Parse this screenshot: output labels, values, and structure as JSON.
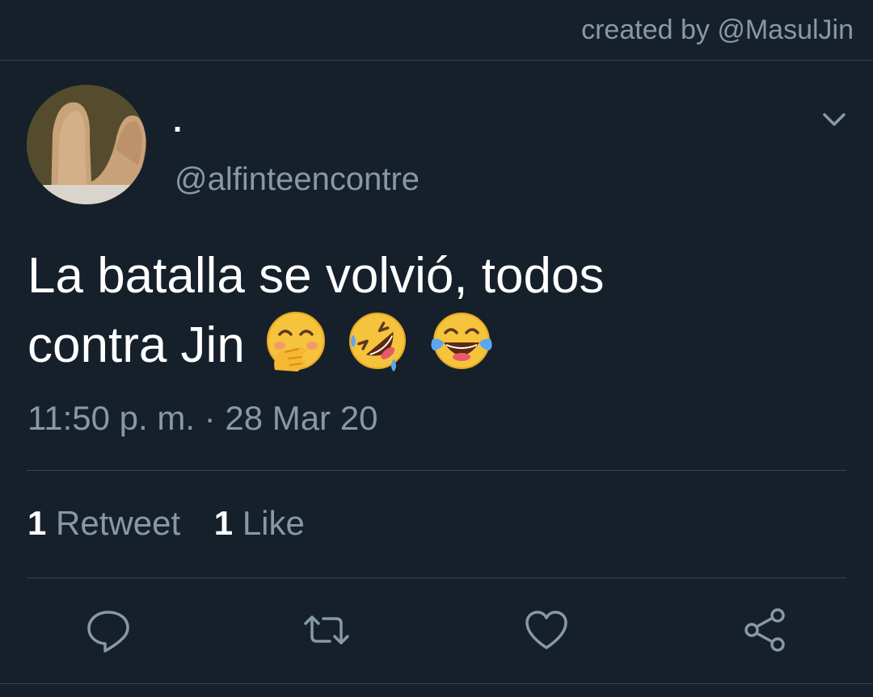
{
  "header": {
    "credit": "created by @MasulJin"
  },
  "tweet": {
    "display_name": ".",
    "handle": "@alfinteencontre",
    "text_line1": "La batalla se volvió, todos",
    "text_line2": "contra Jin",
    "emojis": [
      "face-with-hand-over-mouth-icon",
      "rolling-on-floor-laughing-icon",
      "face-with-tears-of-joy-icon"
    ],
    "timestamp": "11:50 p. m. · 28 Mar 20",
    "retweet_count": "1",
    "retweet_label": "Retweet",
    "like_count": "1",
    "like_label": "Like"
  },
  "actions": [
    "reply-icon",
    "retweet-icon",
    "like-icon",
    "share-icon"
  ],
  "colors": {
    "background": "#15202b",
    "muted_text": "#8899a6",
    "divider": "#38444d",
    "primary_text": "#ffffff"
  }
}
